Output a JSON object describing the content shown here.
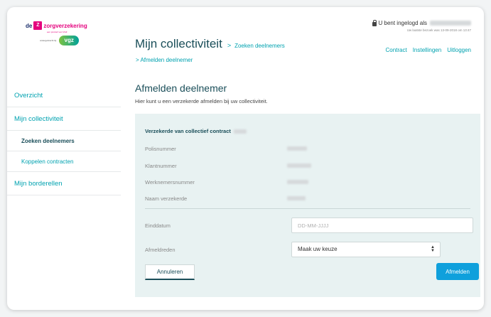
{
  "brand": {
    "logo_prefix": "de",
    "logo_box": "Z",
    "logo_name": "zorgverzekering",
    "logo_tagline": "een product van VGZ",
    "partner_prefix": "ondergebracht bij",
    "partner_name": "vgz"
  },
  "user": {
    "logged_in_label": "U bent ingelogd als",
    "last_login": "Uw laatste bezoek was 13-09-2018 om 13:47"
  },
  "topnav": [
    "Contract",
    "Instellingen",
    "Uitloggen"
  ],
  "header": {
    "title": "Mijn collectiviteit",
    "crumb_separator": ">",
    "crumb_1": "Zoeken deelnemers",
    "crumb_2_prefix": ">",
    "crumb_2": "Afmelden deelnemer"
  },
  "sidebar": {
    "items": [
      {
        "label": "Overzicht"
      },
      {
        "label": "Mijn collectiviteit"
      },
      {
        "label": "Zoeken deelnemers"
      },
      {
        "label": "Koppelen contracten"
      },
      {
        "label": "Mijn borderellen"
      }
    ]
  },
  "main": {
    "title": "Afmelden deelnemer",
    "description": "Hier kunt u een verzekerde afmelden bij uw collectiviteit.",
    "section_title": "Verzekerde van collectief contract",
    "fields": [
      {
        "label": "Polisnummer"
      },
      {
        "label": "Klantnummer"
      },
      {
        "label": "Werknemersnummer"
      },
      {
        "label": "Naam verzekerde"
      }
    ],
    "einddatum_label": "Einddatum",
    "einddatum_placeholder": "DD-MM-JJJJ",
    "reden_label": "Afmeldreden",
    "reden_value": "Maak uw keuze",
    "cancel_label": "Annuleren",
    "submit_label": "Afmelden"
  },
  "colors": {
    "accent": "#00a2b0",
    "heading": "#1a4e59",
    "panel": "#e8f2f2",
    "primary_button": "#0fa0dc",
    "brand_pink": "#e4007d"
  }
}
